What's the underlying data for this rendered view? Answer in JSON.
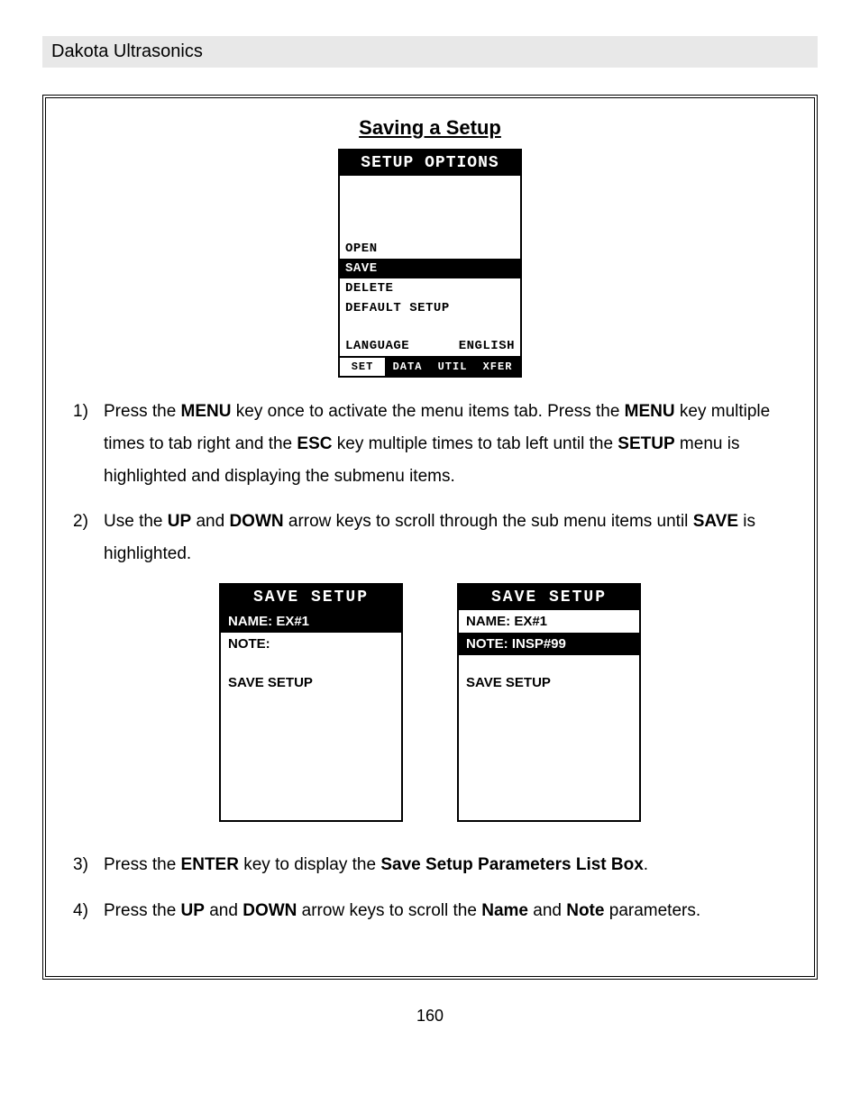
{
  "header": "Dakota Ultrasonics",
  "section_title": "Saving a Setup",
  "screen1": {
    "title": "SETUP OPTIONS",
    "items": {
      "open": "OPEN",
      "save": "SAVE",
      "delete": "DELETE",
      "default": "DEFAULT SETUP",
      "lang_label": "LANGUAGE",
      "lang_value": "ENGLISH"
    },
    "tabs": {
      "set": "SET",
      "data": "DATA",
      "util": "UTIL",
      "xfer": "XFER"
    }
  },
  "screen2": {
    "title": "SAVE SETUP",
    "name": "NAME: EX#1",
    "note": "NOTE:",
    "save": "SAVE SETUP"
  },
  "screen3": {
    "title": "SAVE SETUP",
    "name": "NAME: EX#1",
    "note": "NOTE: INSP#99",
    "save": "SAVE SETUP"
  },
  "steps": {
    "s1_num": "1)",
    "s1_a": "Press the ",
    "s1_b": "MENU",
    "s1_c": " key once to activate the menu items tab.  Press the ",
    "s1_d": "MENU",
    "s1_e": " key multiple times to tab right and the ",
    "s1_f": "ESC",
    "s1_g": " key multiple times to tab left until the ",
    "s1_h": "SETUP",
    "s1_i": " menu is highlighted and displaying the submenu items.",
    "s2_num": "2)",
    "s2_a": " Use the ",
    "s2_b": "UP",
    "s2_c": " and ",
    "s2_d": "DOWN",
    "s2_e": " arrow keys to scroll through the sub menu items until ",
    "s2_f": "SAVE",
    "s2_g": " is highlighted.",
    "s3_num": "3)",
    "s3_a": "Press the ",
    "s3_b": "ENTER",
    "s3_c": " key to display the ",
    "s3_d": "Save Setup Parameters List Box",
    "s3_e": ".",
    "s4_num": "4)",
    "s4_a": "Press the ",
    "s4_b": "UP",
    "s4_c": " and ",
    "s4_d": "DOWN",
    "s4_e": " arrow keys to scroll the ",
    "s4_f": "Name",
    "s4_g": " and ",
    "s4_h": "Note",
    "s4_i": " parameters."
  },
  "page_number": "160"
}
